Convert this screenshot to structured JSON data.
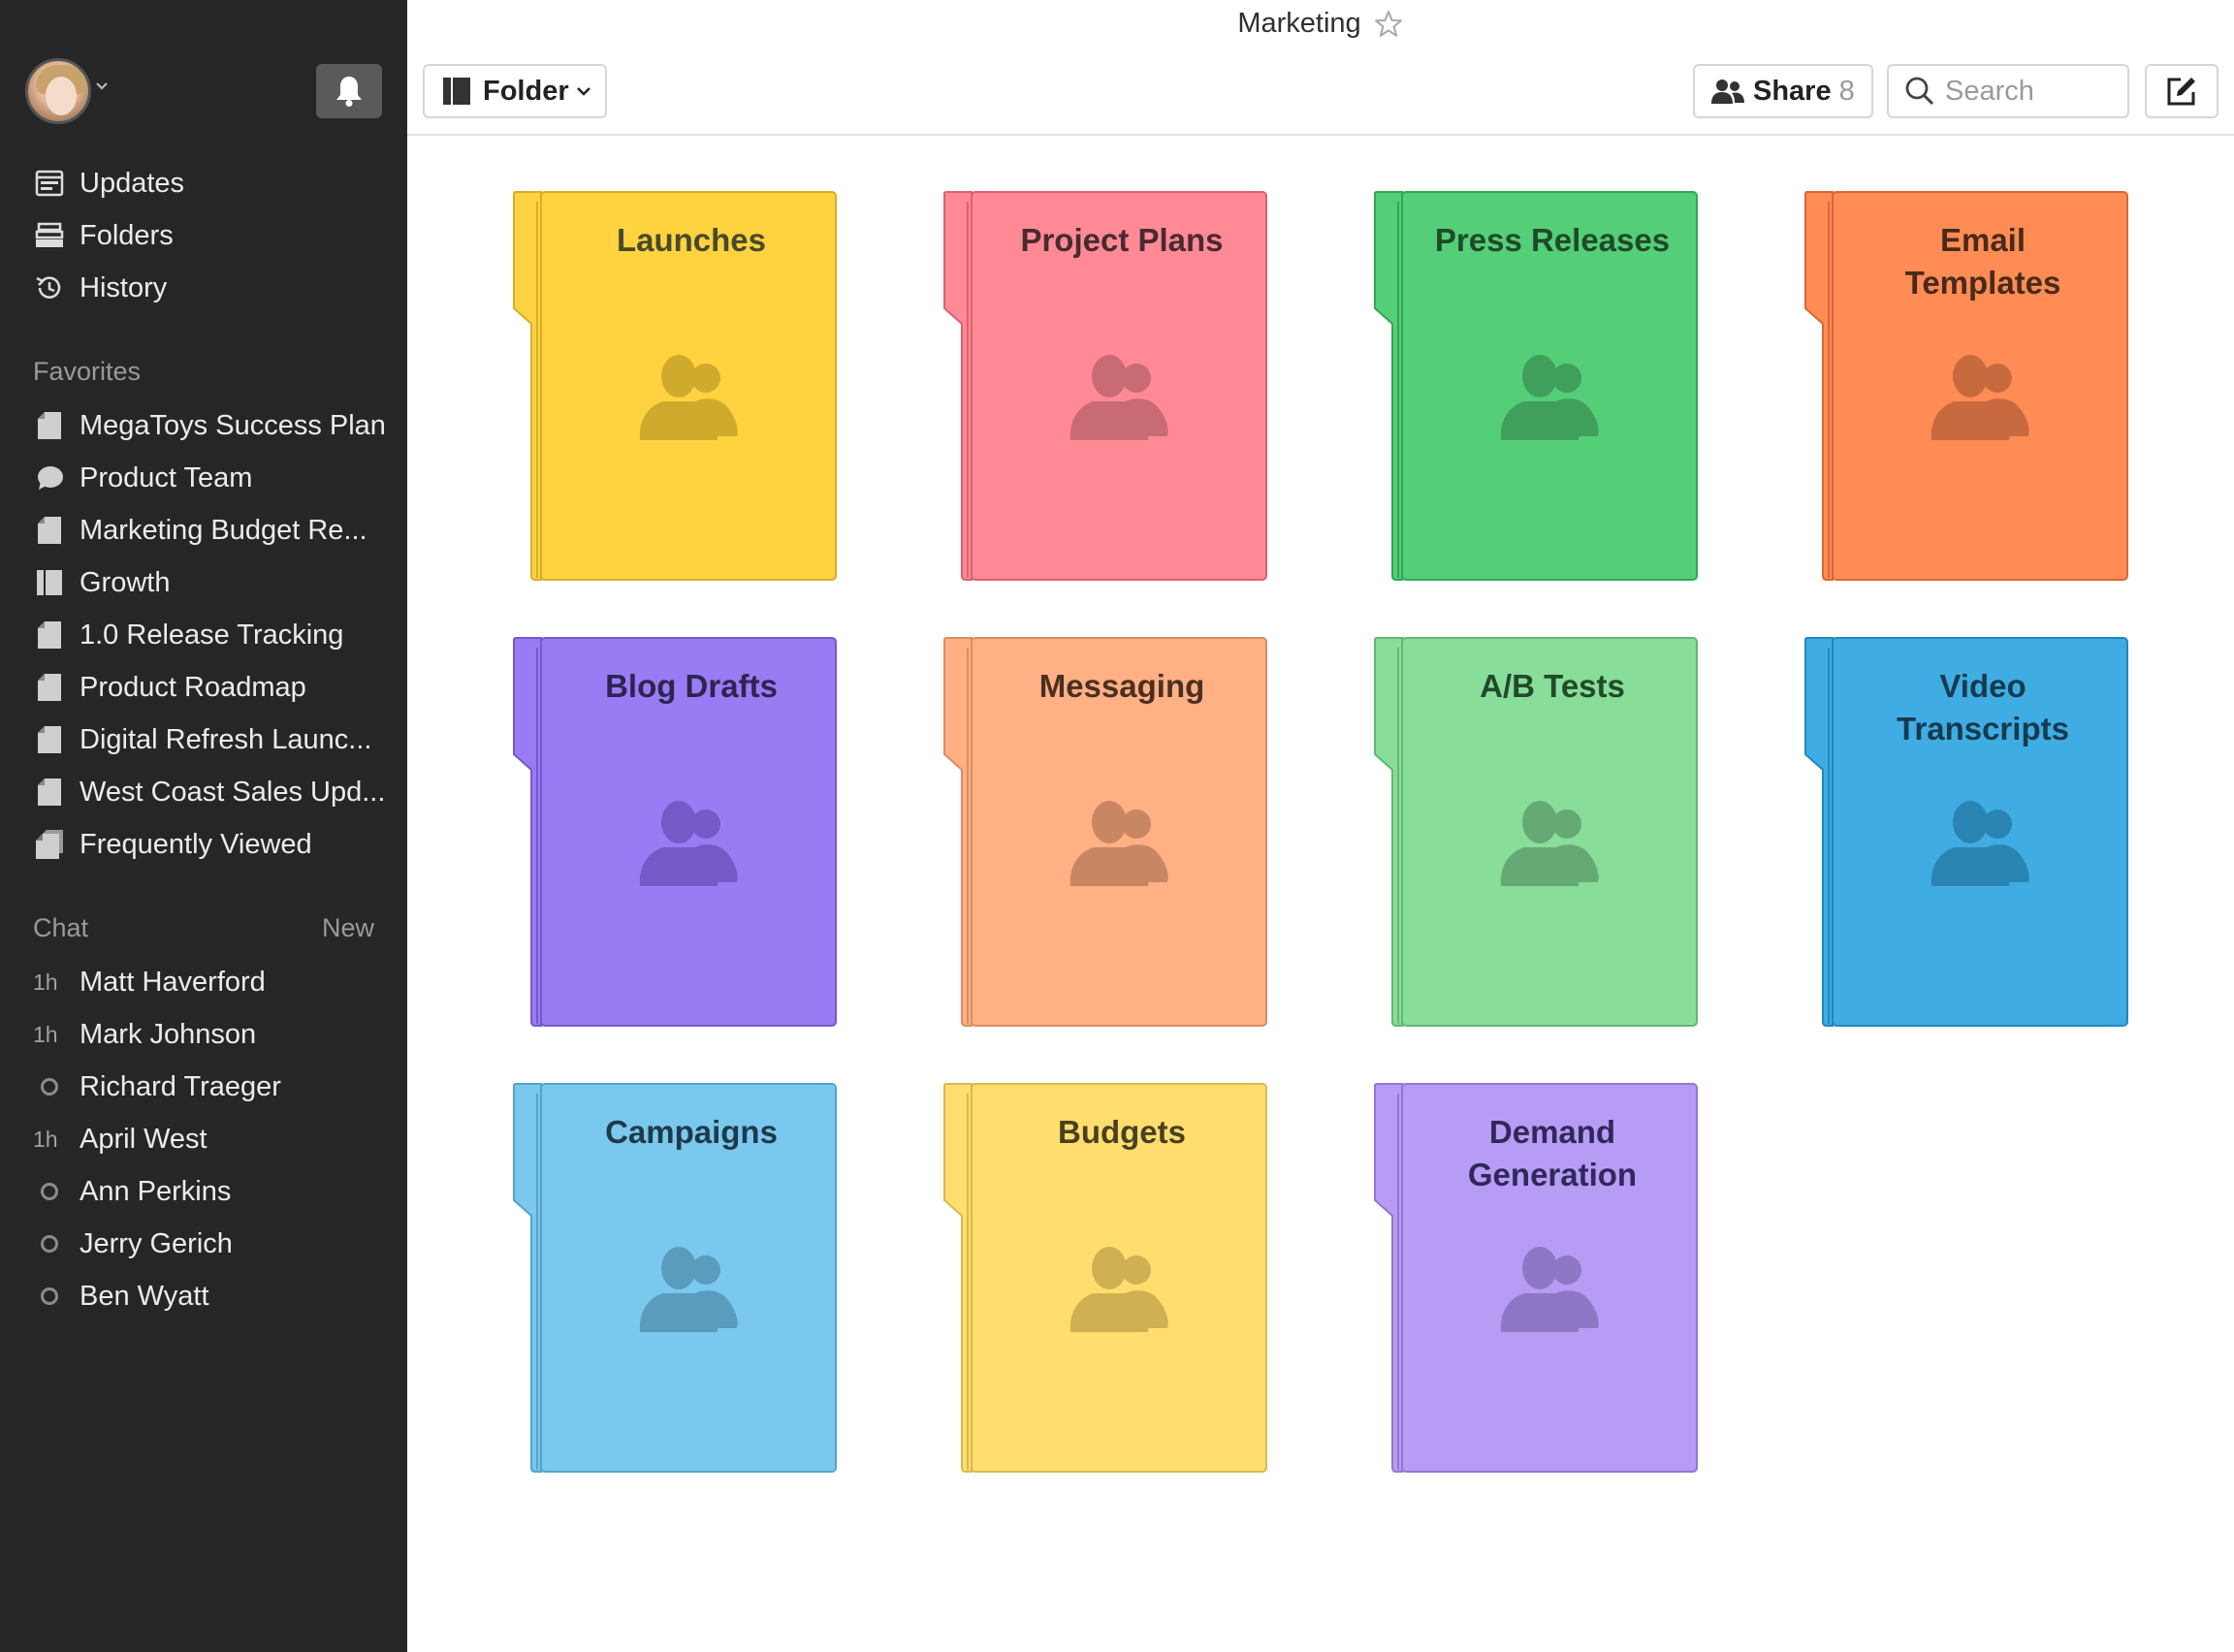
{
  "document_title": "Marketing",
  "toolbar": {
    "folder_label": "Folder",
    "share_label": "Share",
    "share_count": "8",
    "search_placeholder": "Search"
  },
  "sidebar": {
    "nav": [
      {
        "label": "Updates",
        "icon": "updates-icon"
      },
      {
        "label": "Folders",
        "icon": "folders-icon"
      },
      {
        "label": "History",
        "icon": "history-icon"
      }
    ],
    "favorites_heading": "Favorites",
    "favorites": [
      {
        "label": "MegaToys Success Plan",
        "icon": "document-icon"
      },
      {
        "label": "Product Team",
        "icon": "chat-bubble-icon"
      },
      {
        "label": "Marketing Budget Re...",
        "icon": "document-icon"
      },
      {
        "label": "Growth",
        "icon": "folder-icon"
      },
      {
        "label": "1.0 Release Tracking",
        "icon": "document-icon"
      },
      {
        "label": "Product Roadmap",
        "icon": "document-icon"
      },
      {
        "label": "Digital Refresh Launc...",
        "icon": "document-icon"
      },
      {
        "label": "West Coast Sales Upd...",
        "icon": "document-icon"
      },
      {
        "label": "Frequently Viewed",
        "icon": "documents-stack-icon"
      }
    ],
    "chat_heading": "Chat",
    "chat_new": "New",
    "chats": [
      {
        "meta": "1h",
        "name": "Matt Haverford"
      },
      {
        "meta": "1h",
        "name": "Mark Johnson"
      },
      {
        "meta": "",
        "name": "Richard Traeger"
      },
      {
        "meta": "1h",
        "name": "April West"
      },
      {
        "meta": "",
        "name": "Ann Perkins"
      },
      {
        "meta": "",
        "name": "Jerry Gerich"
      },
      {
        "meta": "",
        "name": "Ben Wyatt"
      }
    ]
  },
  "folders": [
    {
      "name": "Launches",
      "color": "#FFD23F",
      "edge": "#D7AE29",
      "text": "#4a4a2a",
      "people": "#CFAA2C"
    },
    {
      "name": "Project Plans",
      "color": "#FF8A95",
      "edge": "#D9626E",
      "text": "#4a2a30",
      "people": "#C96B74"
    },
    {
      "name": "Press Releases",
      "color": "#55CE78",
      "edge": "#33A655",
      "text": "#1f4a2a",
      "people": "#3F9F5B"
    },
    {
      "name": "Email Templates",
      "color": "#FF8C55",
      "edge": "#D96736",
      "text": "#4a2a1a",
      "people": "#C86A40"
    },
    {
      "name": "Blog Drafts",
      "color": "#997CF3",
      "edge": "#7658CF",
      "text": "#2e2450",
      "people": "#7559C6"
    },
    {
      "name": "Messaging",
      "color": "#FFB085",
      "edge": "#DB8C61",
      "text": "#4a3020",
      "people": "#C98662"
    },
    {
      "name": "A/B Tests",
      "color": "#88DD99",
      "edge": "#62B874",
      "text": "#214a2a",
      "people": "#65AA74"
    },
    {
      "name": "Video Transcripts",
      "color": "#3FADE3",
      "edge": "#1E88C0",
      "text": "#173a4e",
      "people": "#2A84B2"
    },
    {
      "name": "Campaigns",
      "color": "#7BC8EE",
      "edge": "#55A3CA",
      "text": "#1e3a4a",
      "people": "#5A9CBD"
    },
    {
      "name": "Budgets",
      "color": "#FFDE6F",
      "edge": "#D9B94C",
      "text": "#4a4020",
      "people": "#CFB052"
    },
    {
      "name": "Demand Generation",
      "color": "#B79CF5",
      "edge": "#9278D0",
      "text": "#30285a",
      "people": "#8E77C4"
    }
  ]
}
